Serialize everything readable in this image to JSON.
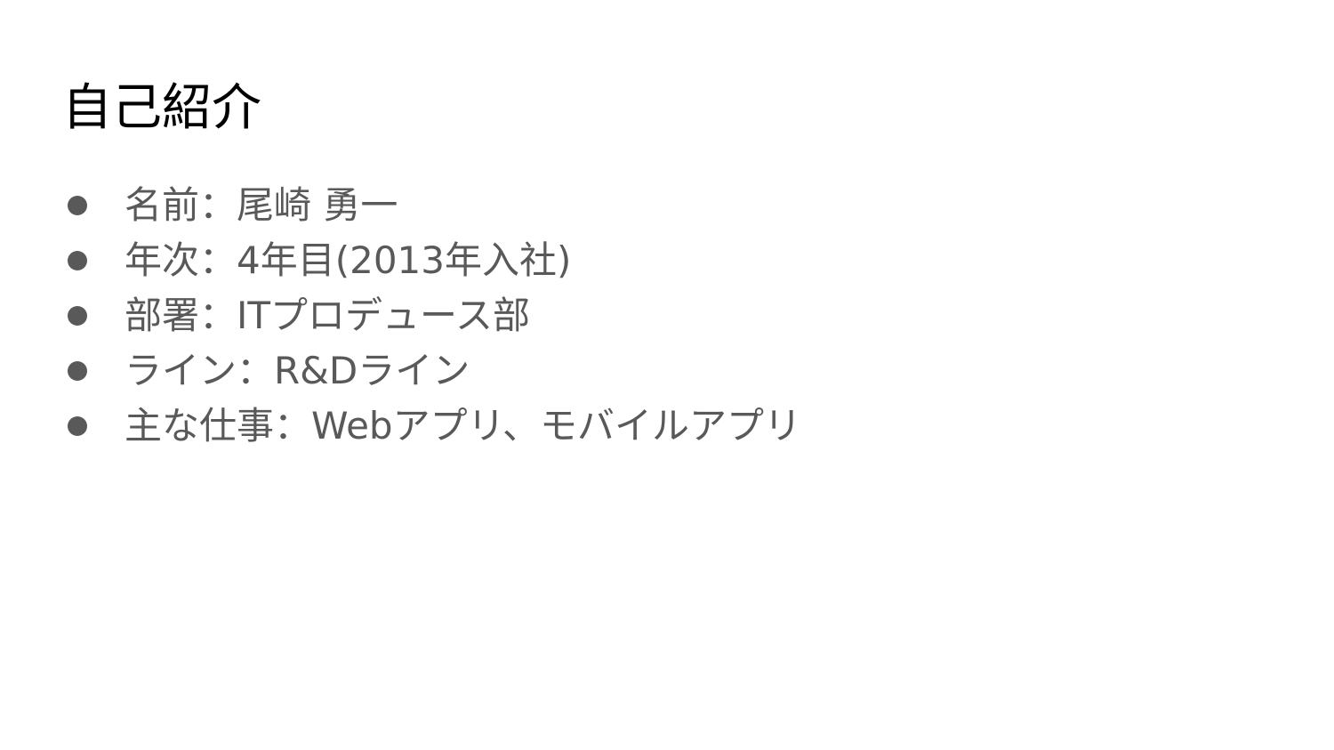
{
  "slide": {
    "title": "自己紹介",
    "items": [
      {
        "text": "名前：尾崎 勇一"
      },
      {
        "text": "年次：4年目(2013年入社)"
      },
      {
        "text": "部署：ITプロデュース部"
      },
      {
        "text": "ライン：R&Dライン"
      },
      {
        "text": "主な仕事：Webアプリ、モバイルアプリ"
      }
    ],
    "colors": {
      "title": "#000000",
      "body": "#595959",
      "background": "#ffffff"
    }
  }
}
